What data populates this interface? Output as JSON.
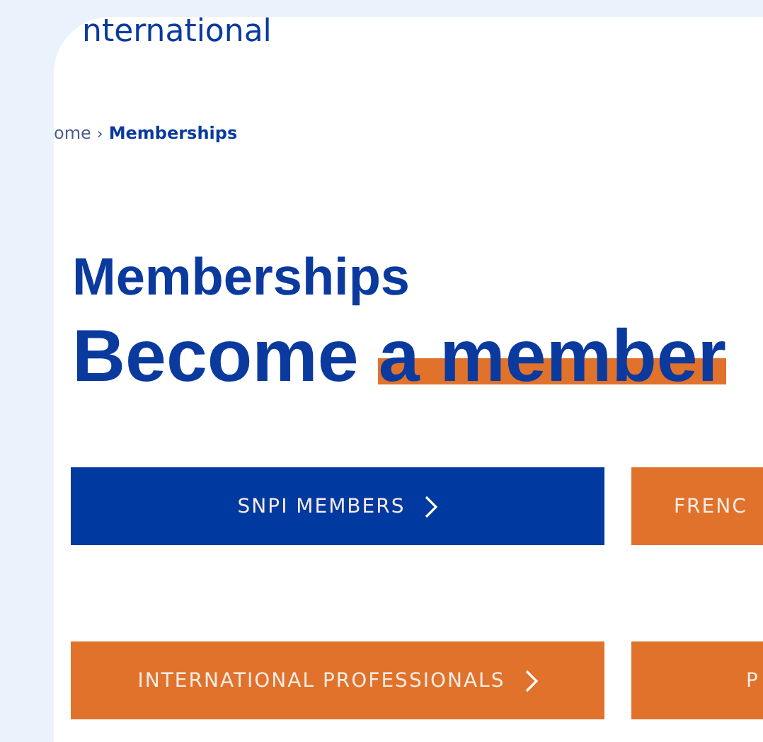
{
  "logo": {
    "text": "nternational"
  },
  "breadcrumb": {
    "separator": "›",
    "items": [
      {
        "label": "ome",
        "current": false
      },
      {
        "label": "Memberships",
        "current": true
      }
    ]
  },
  "title": "Memberships",
  "headline": {
    "lead": "Become",
    "highlight": "a member"
  },
  "membership_buttons": [
    {
      "label": "SNPI MEMBERS",
      "color": "#0039a0",
      "chevron": true
    },
    {
      "label": "FRENC",
      "color": "#e0722c"
    },
    {
      "label": "INTERNATIONAL PROFESSIONALS",
      "color": "#e0722c",
      "chevron": true
    },
    {
      "label": "P",
      "color": "#e0722c"
    }
  ]
}
